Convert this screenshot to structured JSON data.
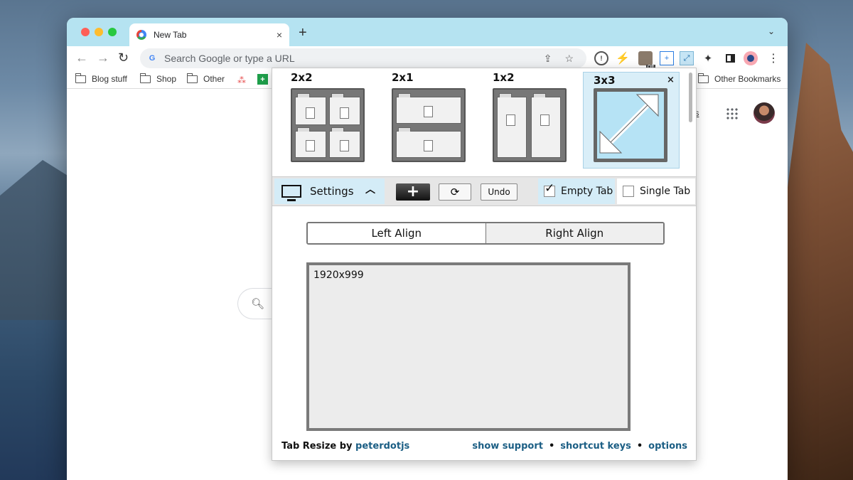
{
  "browser": {
    "tab_title": "New Tab",
    "tab_close": "×",
    "new_tab": "+",
    "tab_menu": "⌄",
    "omnibox_placeholder": "Search Google or type a URL",
    "ext_off_badge": "Off",
    "bookmarks": [
      "Blog stuff",
      "Shop",
      "Other"
    ],
    "other_bookmarks": "Other Bookmarks",
    "page_link_partial": "ges"
  },
  "popup": {
    "layouts": [
      {
        "label": "2x2"
      },
      {
        "label": "2x1"
      },
      {
        "label": "1x2"
      },
      {
        "label": "3x3",
        "selected": true
      }
    ],
    "close": "×",
    "settings_label": "Settings",
    "undo_label": "Undo",
    "empty_tab": {
      "label": "Empty Tab",
      "checked": true
    },
    "single_tab": {
      "label": "Single Tab",
      "checked": false
    },
    "align": {
      "left": "Left Align",
      "right": "Right Align",
      "selected": "right"
    },
    "resolution_text": "1920x999",
    "footer": {
      "credit_prefix": "Tab Resize by",
      "credit_author": "peterdotjs",
      "links": [
        "show support",
        "shortcut keys",
        "options"
      ],
      "separator": "•"
    }
  },
  "colors": {
    "tabbar": "#b5e3f1",
    "popup_highlight": "#d4ecf7",
    "link": "#1b5e84"
  }
}
